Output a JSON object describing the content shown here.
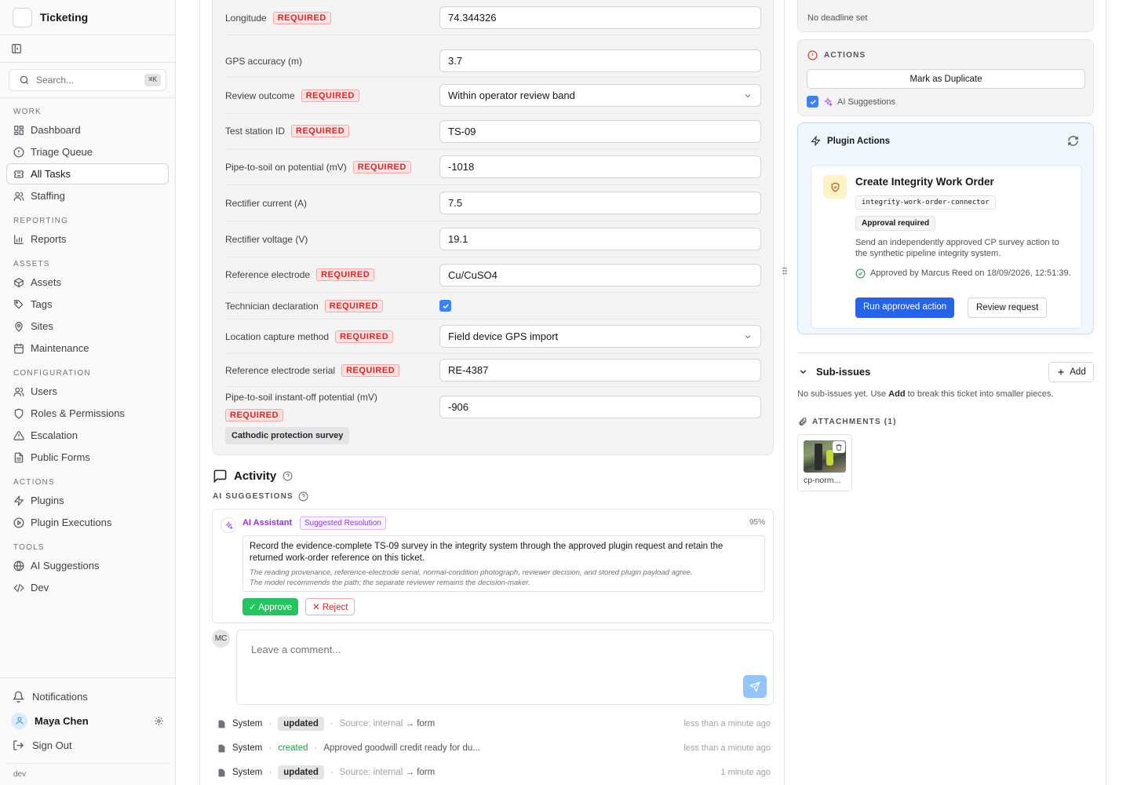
{
  "app": {
    "name": "Ticketing",
    "env": "dev"
  },
  "search": {
    "placeholder": "Search...",
    "shortcut": "⌘K"
  },
  "nav": [
    {
      "title": "WORK",
      "items": [
        {
          "label": "Dashboard",
          "icon": "grid-icon"
        },
        {
          "label": "Triage Queue",
          "icon": "alert-circle-icon"
        },
        {
          "label": "All Tasks",
          "icon": "ticket-icon",
          "active": true
        },
        {
          "label": "Staffing",
          "icon": "users-icon"
        }
      ]
    },
    {
      "title": "REPORTING",
      "items": [
        {
          "label": "Reports",
          "icon": "bar-chart-icon"
        }
      ]
    },
    {
      "title": "ASSETS",
      "items": [
        {
          "label": "Assets",
          "icon": "box-icon"
        },
        {
          "label": "Tags",
          "icon": "tag-icon"
        },
        {
          "label": "Sites",
          "icon": "map-pin-icon"
        },
        {
          "label": "Maintenance",
          "icon": "calendar-icon"
        }
      ]
    },
    {
      "title": "CONFIGURATION",
      "items": [
        {
          "label": "Users",
          "icon": "users-icon"
        },
        {
          "label": "Roles & Permissions",
          "icon": "shield-icon"
        },
        {
          "label": "Escalation",
          "icon": "triangle-alert-icon"
        },
        {
          "label": "Public Forms",
          "icon": "file-text-icon"
        }
      ]
    },
    {
      "title": "ACTIONS",
      "items": [
        {
          "label": "Plugins",
          "icon": "zap-icon"
        },
        {
          "label": "Plugin Executions",
          "icon": "play-circle-icon"
        }
      ]
    },
    {
      "title": "TOOLS",
      "items": [
        {
          "label": "AI Suggestions",
          "icon": "globe-icon"
        },
        {
          "label": "Dev",
          "icon": "code-icon"
        }
      ]
    }
  ],
  "sidebar_bottom": {
    "notifications": "Notifications",
    "user_name": "Maya Chen",
    "sign_out": "Sign Out"
  },
  "form": {
    "fields": [
      {
        "label": "Longitude",
        "required": true,
        "type": "text",
        "value": "74.344326"
      },
      {
        "label": "GPS accuracy (m)",
        "required": false,
        "type": "text",
        "value": "3.7"
      },
      {
        "label": "Review outcome",
        "required": true,
        "type": "select",
        "value": "Within operator review band"
      },
      {
        "label": "Test station ID",
        "required": true,
        "type": "text",
        "value": "TS-09"
      },
      {
        "label": "Pipe-to-soil on potential (mV)",
        "required": true,
        "type": "text",
        "value": "-1018"
      },
      {
        "label": "Rectifier current (A)",
        "required": false,
        "type": "text",
        "value": "7.5"
      },
      {
        "label": "Rectifier voltage (V)",
        "required": false,
        "type": "text",
        "value": "19.1"
      },
      {
        "label": "Reference electrode",
        "required": true,
        "type": "text",
        "value": "Cu/CuSO4"
      },
      {
        "label": "Technician declaration",
        "required": true,
        "type": "checkbox",
        "value": ""
      },
      {
        "label": "Location capture method",
        "required": true,
        "type": "select",
        "value": "Field device GPS import"
      },
      {
        "label": "Reference electrode serial",
        "required": true,
        "type": "text",
        "value": "RE-4387"
      },
      {
        "label": "Pipe-to-soil instant-off potential (mV)",
        "required": true,
        "type": "text",
        "value": "-906"
      }
    ],
    "required_label": "REQUIRED",
    "form_tag": "Cathodic protection survey"
  },
  "activity": {
    "title": "Activity",
    "ai_heading": "AI SUGGESTIONS",
    "suggestion": {
      "author": "AI Assistant",
      "badge": "Suggested Resolution",
      "confidence": "95%",
      "text": "Record the evidence-complete TS-09 survey in the integrity system through the approved plugin request and retain the returned work-order reference on this ticket.",
      "reason_1": "The reading provenance, reference-electrode serial, normal-condition photograph, reviewer decision, and stored plugin payload agree.",
      "reason_2": "The model recommends the path; the separate reviewer remains the decision-maker.",
      "approve": "✓ Approve",
      "reject": "✕ Reject"
    },
    "comment": {
      "avatar": "MC",
      "placeholder": "Leave a comment..."
    },
    "log": [
      {
        "actor": "System",
        "action": "updated",
        "kind": "update",
        "source_key": "Source:",
        "source_from": "internal",
        "source_to": "form",
        "detail": "",
        "time": "less than a minute ago"
      },
      {
        "actor": "System",
        "action": "created",
        "kind": "create",
        "detail": "Approved goodwill credit ready for du...",
        "time": "less than a minute ago"
      },
      {
        "actor": "System",
        "action": "updated",
        "kind": "update",
        "source_key": "Source:",
        "source_from": "internal",
        "source_to": "form",
        "detail": "",
        "time": "1 minute ago"
      }
    ]
  },
  "right": {
    "deadline": "No deadline set",
    "actions": {
      "title": "ACTIONS",
      "duplicate": "Mark as Duplicate",
      "ai_toggle": "AI Suggestions"
    },
    "plugin": {
      "title": "Plugin Actions",
      "action_title": "Create Integrity Work Order",
      "connector": "integrity-work-order-connector",
      "approval_badge": "Approval required",
      "description": "Send an independently approved CP survey action to the synthetic pipeline integrity system.",
      "approved_text": "Approved by Marcus Reed on 18/09/2026, 12:51:39.",
      "run": "Run approved action",
      "review": "Review request"
    },
    "subissues": {
      "title": "Sub-issues",
      "add": "Add",
      "empty_pre": "No sub-issues yet. Use",
      "empty_bold": "Add",
      "empty_post": "to break this ticket into smaller pieces."
    },
    "attachments": {
      "title": "ATTACHMENTS (1)",
      "files": [
        {
          "name": "cp-norm..."
        }
      ]
    }
  },
  "colors": {
    "accent": "#2563eb",
    "required": "#dc2626",
    "ai": "#9333ea",
    "success": "#22c55e"
  }
}
